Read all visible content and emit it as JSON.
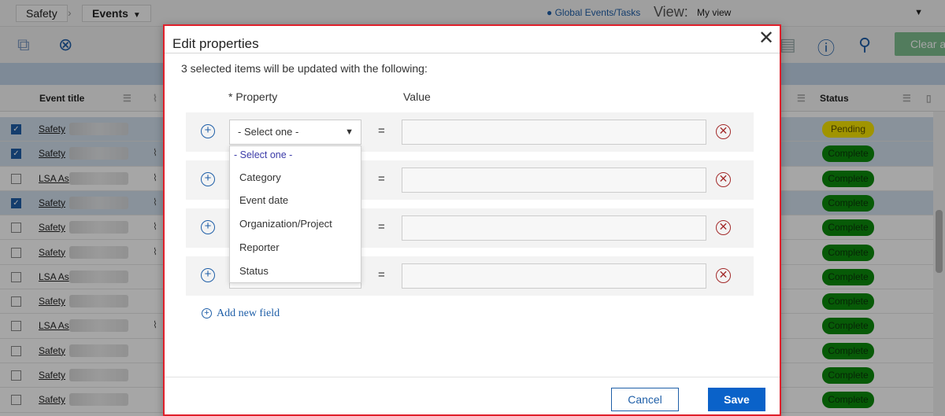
{
  "app": {
    "breadcrumb_app": "Safety",
    "breadcrumb_module": "Events",
    "global_link": "Global Events/Tasks",
    "view_label": "View:",
    "view_value": "My view",
    "clear_label": "Clear a"
  },
  "table": {
    "col_title": "Event title",
    "col_status": "Status",
    "rows": [
      {
        "title": "Safety",
        "checked": true,
        "clip": false,
        "status": "Pending"
      },
      {
        "title": "Safety",
        "checked": true,
        "clip": true,
        "status": "Complete"
      },
      {
        "title": "LSA As",
        "checked": false,
        "clip": true,
        "status": "Complete"
      },
      {
        "title": "Safety",
        "checked": true,
        "clip": true,
        "status": "Complete"
      },
      {
        "title": "Safety",
        "checked": false,
        "clip": true,
        "status": "Complete"
      },
      {
        "title": "Safety",
        "checked": false,
        "clip": true,
        "status": "Complete"
      },
      {
        "title": "LSA As",
        "checked": false,
        "clip": false,
        "status": "Complete"
      },
      {
        "title": "Safety",
        "checked": false,
        "clip": false,
        "status": "Complete"
      },
      {
        "title": "LSA As",
        "checked": false,
        "clip": true,
        "status": "Complete"
      },
      {
        "title": "Safety",
        "checked": false,
        "clip": false,
        "status": "Complete"
      },
      {
        "title": "Safety",
        "checked": false,
        "clip": false,
        "status": "Complete"
      },
      {
        "title": "Safety",
        "checked": false,
        "clip": false,
        "status": "Complete"
      }
    ]
  },
  "modal": {
    "title": "Edit properties",
    "close_glyph": "✕",
    "subtitle": "3 selected items will be updated with the following:",
    "col_property": "* Property",
    "col_value": "Value",
    "select_placeholder": "- Select one -",
    "equals": "=",
    "dropdown": {
      "placeholder": "- Select one -",
      "options": [
        "Category",
        "Event date",
        "Organization/Project",
        "Reporter",
        "Status"
      ]
    },
    "add_field": "Add new field",
    "cancel": "Cancel",
    "save": "Save"
  },
  "colors": {
    "accent": "#1f5fa8",
    "save": "#0a62c9",
    "highlight_border": "#e0202b",
    "pending": "#f6e400",
    "complete": "#0c8a0c"
  }
}
